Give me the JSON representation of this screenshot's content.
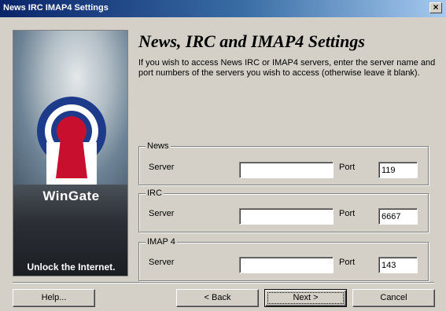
{
  "window": {
    "title": "News IRC IMAP4 Settings",
    "close_glyph": "×"
  },
  "banner": {
    "brand": "WinGate",
    "slogan": "Unlock the Internet.",
    "logo_colors": {
      "ring": "#1e3a8a",
      "keyhole": "#c8102e",
      "white": "#ffffff"
    }
  },
  "main": {
    "heading": "News, IRC and IMAP4 Settings",
    "intro": "If you wish to access News IRC or IMAP4 servers, enter the server name and port numbers of the servers you wish to access (otherwise leave it blank)."
  },
  "groups": {
    "news": {
      "label": "News",
      "server_label": "Server",
      "server_value": "",
      "port_label": "Port",
      "port_value": "119"
    },
    "irc": {
      "label": "IRC",
      "server_label": "Server",
      "server_value": "",
      "port_label": "Port",
      "port_value": "6667"
    },
    "imap": {
      "label": "IMAP 4",
      "server_label": "Server",
      "server_value": "",
      "port_label": "Port",
      "port_value": "143"
    }
  },
  "buttons": {
    "help": "Help...",
    "back": "< Back",
    "next": "Next >",
    "cancel": "Cancel"
  }
}
